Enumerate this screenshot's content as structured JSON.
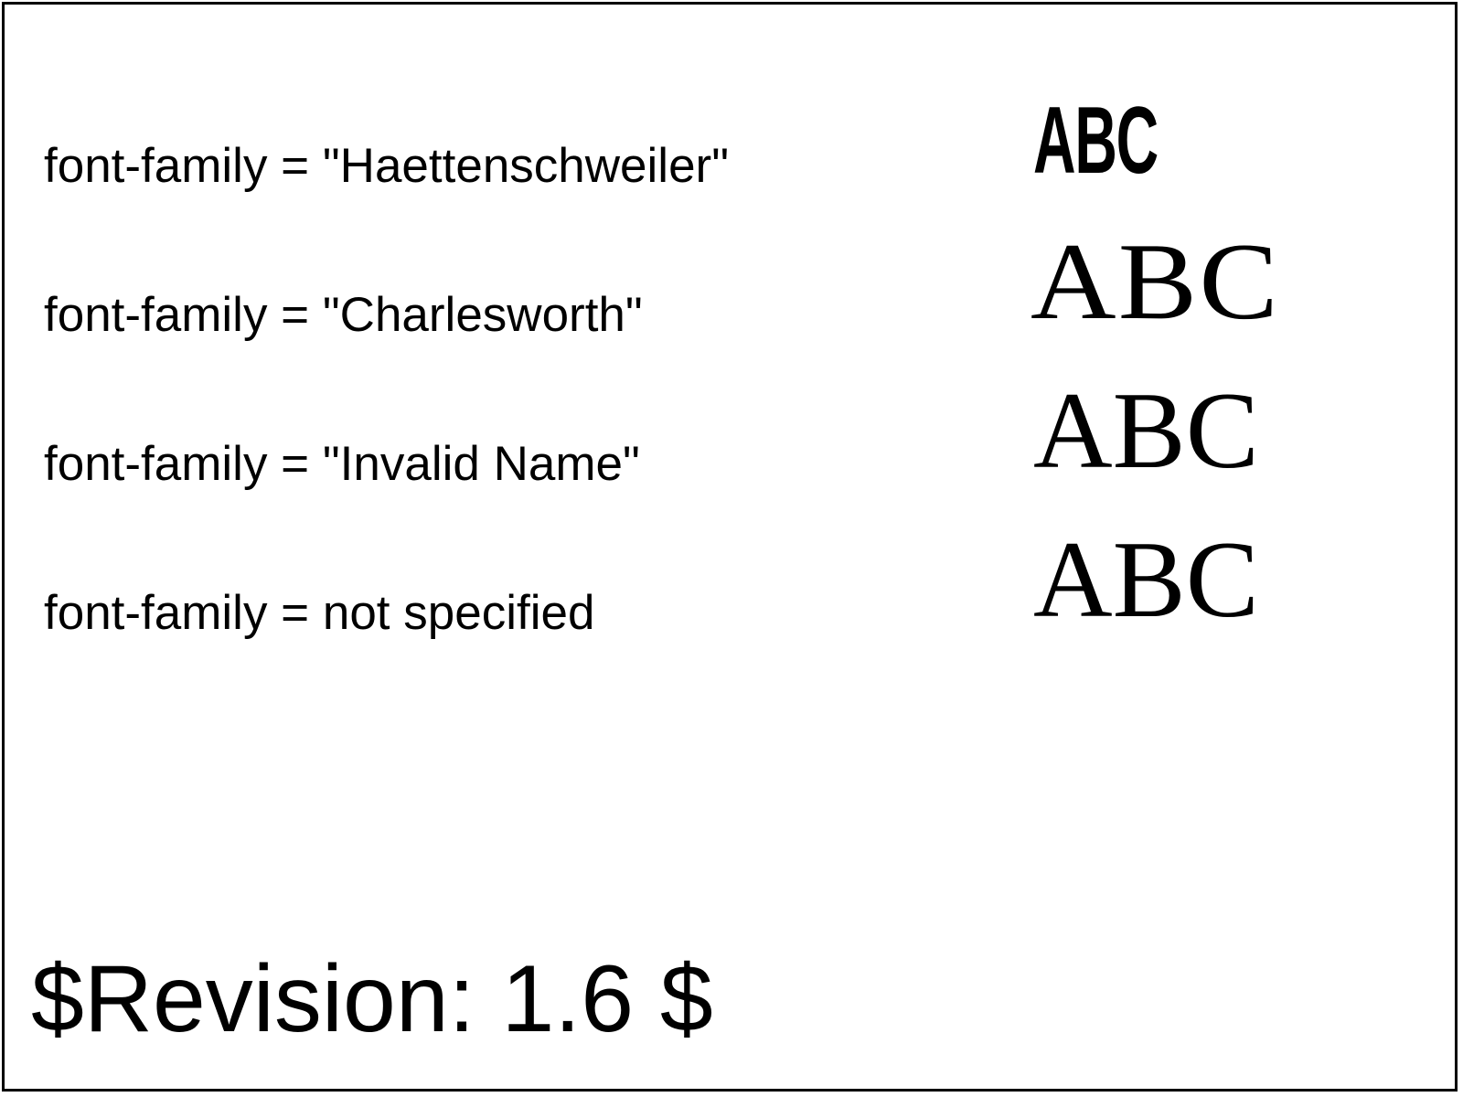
{
  "rows": [
    {
      "label": "font-family = \"Haettenschweiler\"",
      "sample": "ABC"
    },
    {
      "label": "font-family = \"Charlesworth\"",
      "sample": "ABC"
    },
    {
      "label": "font-family = \"Invalid Name\"",
      "sample": "ABC"
    },
    {
      "label": "font-family = not specified",
      "sample": "ABC"
    }
  ],
  "revision": "$Revision: 1.6 $"
}
